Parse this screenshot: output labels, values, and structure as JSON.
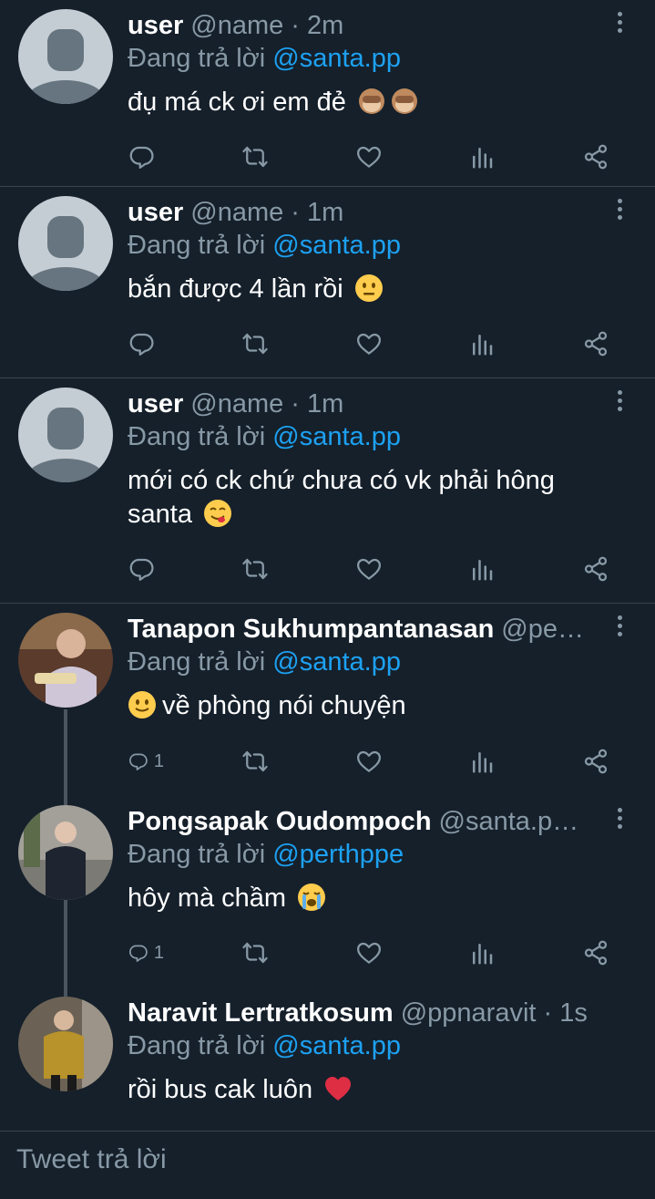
{
  "reply_prefix": "Đang trả lời",
  "tweets": [
    {
      "name": "user",
      "handle": "@name · 2m",
      "reply_to": "@santa.pp",
      "text": "đụ má ck ơi em đẻ",
      "emoji": "see-no-evil-monkey x2",
      "reply_count": ""
    },
    {
      "name": "user",
      "handle": "@name · 1m",
      "reply_to": "@santa.pp",
      "text": "bắn được 4 lần rồi",
      "emoji": "neutral-face",
      "reply_count": ""
    },
    {
      "name": "user",
      "handle": "@name · 1m",
      "reply_to": "@santa.pp",
      "text": "mới có ck chứ chưa có vk phải hông santa",
      "emoji": "yum-face",
      "reply_count": ""
    },
    {
      "name": "Tanapon Sukhumpantanasan",
      "handle": "@pert…",
      "reply_to": "@santa.pp",
      "text": "về phòng nói chuyện",
      "emoji": "slight-smile-face",
      "reply_count": "1"
    },
    {
      "name": "Pongsapak Oudompoch",
      "handle": "@santa.pp …",
      "reply_to": "@perthppe",
      "text": "hôy mà chầm",
      "emoji": "loudly-crying-face",
      "reply_count": "1"
    },
    {
      "name": "Naravit Lertratkosum",
      "handle": "@ppnaravit · 1s",
      "reply_to": "@santa.pp",
      "text": "rồi bus cak luôn",
      "emoji": "red-heart",
      "reply_count": ""
    }
  ],
  "compose": {
    "placeholder": "Tweet trả lời"
  },
  "colors": {
    "background": "#15202b",
    "link": "#1da1f2",
    "muted": "#8899a6",
    "divider": "#38444d"
  }
}
